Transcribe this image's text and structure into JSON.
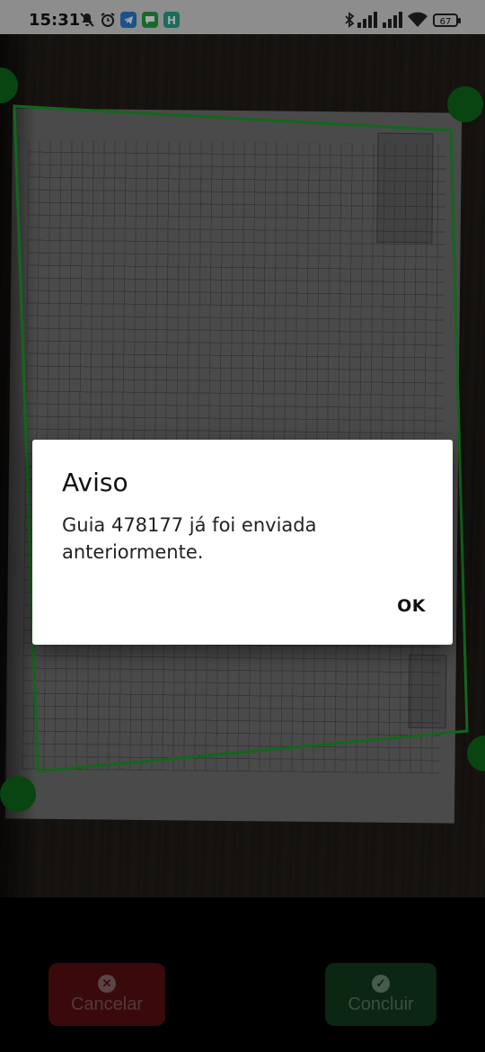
{
  "status_bar": {
    "time": "15:31",
    "battery": "67",
    "icons": [
      "mute-icon",
      "alarm-icon",
      "telegram-icon",
      "messages-icon",
      "h-app-icon",
      "bluetooth-icon",
      "signal-icon",
      "signal-icon",
      "wifi-icon"
    ]
  },
  "dialog": {
    "title": "Aviso",
    "message": "Guia 478177 já foi enviada anteriormente.",
    "ok_label": "OK"
  },
  "bottom_bar": {
    "cancel_label": "Cancelar",
    "cancel_icon": "close-circle-icon",
    "done_label": "Concluir",
    "done_icon": "check-circle-icon"
  },
  "colors": {
    "crop_outline": "#1e9e2a",
    "cancel_bg": "#5a0f12",
    "done_bg": "#123b1c"
  }
}
